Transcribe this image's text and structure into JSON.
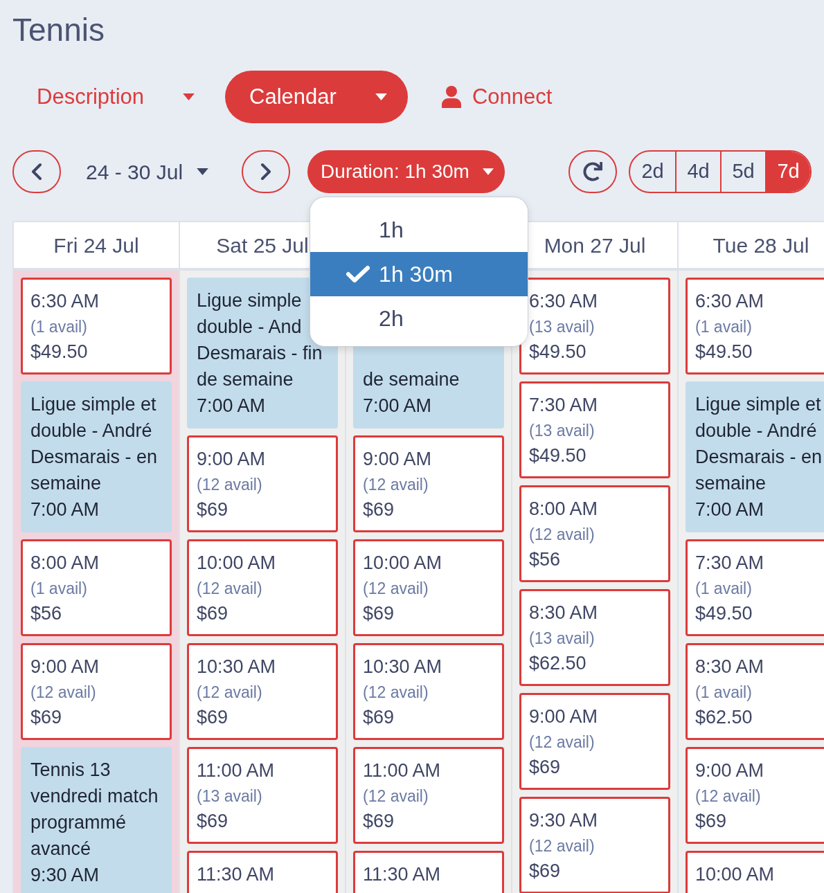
{
  "title": "Tennis",
  "tabs": [
    {
      "label": "Description",
      "kind": "dropdown",
      "selected": false
    },
    {
      "label": "Calendar",
      "kind": "dropdown",
      "selected": true
    },
    {
      "label": "Connect",
      "kind": "account",
      "selected": false
    }
  ],
  "toolbar": {
    "date_range": "24 - 30 Jul",
    "duration": {
      "label": "Duration: 1h 30m",
      "expanded": true,
      "options": [
        {
          "label": "1h",
          "selected": false
        },
        {
          "label": "1h 30m",
          "selected": true
        },
        {
          "label": "2h",
          "selected": false
        }
      ]
    },
    "views": [
      {
        "label": "2d",
        "selected": false
      },
      {
        "label": "4d",
        "selected": false
      },
      {
        "label": "5d",
        "selected": false
      },
      {
        "label": "7d",
        "selected": true
      }
    ]
  },
  "calendar": {
    "columns": [
      {
        "header": "Fri 24 Jul",
        "highlighted": true,
        "items": [
          {
            "kind": "slot",
            "time": "6:30 AM",
            "availability": "(1 avail)",
            "price": "$49.50"
          },
          {
            "kind": "event",
            "title": "Ligue simple et double - André Desmarais - en semaine",
            "time": "7:00 AM"
          },
          {
            "kind": "slot",
            "time": "8:00 AM",
            "availability": "(1 avail)",
            "price": "$56"
          },
          {
            "kind": "slot",
            "time": "9:00 AM",
            "availability": "(12 avail)",
            "price": "$69"
          },
          {
            "kind": "event",
            "title": "Tennis 13 vendredi match programmé avancé",
            "time": "9:30 AM"
          }
        ]
      },
      {
        "header": "Sat 25 Jul",
        "highlighted": false,
        "items": [
          {
            "kind": "event",
            "title": "Ligue simple double - And Desmarais - fin de semaine",
            "time": "7:00 AM"
          },
          {
            "kind": "slot",
            "time": "9:00 AM",
            "availability": "(12 avail)",
            "price": "$69"
          },
          {
            "kind": "slot",
            "time": "10:00 AM",
            "availability": "(12 avail)",
            "price": "$69"
          },
          {
            "kind": "slot",
            "time": "10:30 AM",
            "availability": "(12 avail)",
            "price": "$69"
          },
          {
            "kind": "slot",
            "time": "11:00 AM",
            "availability": "(13 avail)",
            "price": "$69"
          },
          {
            "kind": "slot",
            "time": "11:30 AM"
          }
        ]
      },
      {
        "highlighted": false,
        "items": [
          {
            "kind": "event",
            "title": "de semaine",
            "time": "7:00 AM"
          },
          {
            "kind": "slot",
            "time": "9:00 AM",
            "availability": "(12 avail)",
            "price": "$69"
          },
          {
            "kind": "slot",
            "time": "10:00 AM",
            "availability": "(12 avail)",
            "price": "$69"
          },
          {
            "kind": "slot",
            "time": "10:30 AM",
            "availability": "(12 avail)",
            "price": "$69"
          },
          {
            "kind": "slot",
            "time": "11:00 AM",
            "availability": "(12 avail)",
            "price": "$69"
          },
          {
            "kind": "slot",
            "time": "11:30 AM"
          }
        ]
      },
      {
        "header": "Mon 27 Jul",
        "highlighted": false,
        "items": [
          {
            "kind": "slot",
            "time": "6:30 AM",
            "availability": "(13 avail)",
            "price": "$49.50"
          },
          {
            "kind": "slot",
            "time": "7:30 AM",
            "availability": "(13 avail)",
            "price": "$49.50"
          },
          {
            "kind": "slot",
            "time": "8:00 AM",
            "availability": "(12 avail)",
            "price": "$56"
          },
          {
            "kind": "slot",
            "time": "8:30 AM",
            "availability": "(13 avail)",
            "price": "$62.50"
          },
          {
            "kind": "slot",
            "time": "9:00 AM",
            "availability": "(12 avail)",
            "price": "$69"
          },
          {
            "kind": "slot",
            "time": "9:30 AM",
            "availability": "(12 avail)",
            "price": "$69"
          }
        ]
      },
      {
        "header": "Tue 28 Jul",
        "highlighted": false,
        "items": [
          {
            "kind": "slot",
            "time": "6:30 AM",
            "availability": "(1 avail)",
            "price": "$49.50"
          },
          {
            "kind": "event",
            "title": "Ligue simple et double - André Desmarais - en semaine",
            "time": "7:00 AM"
          },
          {
            "kind": "slot",
            "time": "7:30 AM",
            "availability": "(1 avail)",
            "price": "$49.50"
          },
          {
            "kind": "slot",
            "time": "8:30 AM",
            "availability": "(1 avail)",
            "price": "$62.50"
          },
          {
            "kind": "slot",
            "time": "9:00 AM",
            "availability": "(12 avail)",
            "price": "$69"
          },
          {
            "kind": "slot",
            "time": "10:00 AM"
          }
        ]
      }
    ]
  }
}
